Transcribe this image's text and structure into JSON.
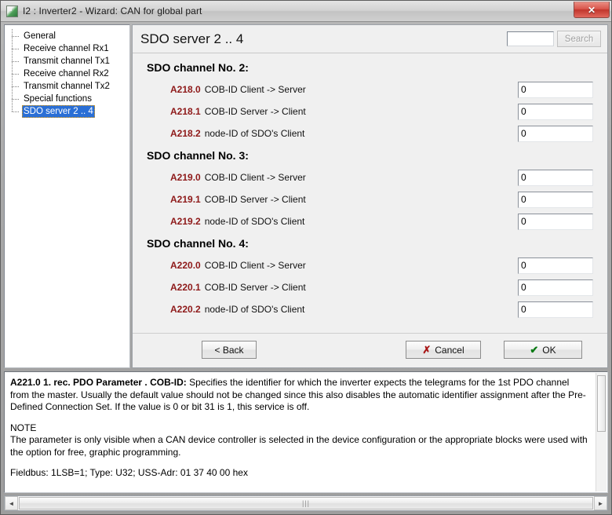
{
  "window": {
    "title": "I2 : Inverter2 - Wizard: CAN for global part",
    "app_icon": "app-square-icon",
    "close_label": "✕"
  },
  "sidebar": {
    "items": [
      {
        "label": "General",
        "selected": false
      },
      {
        "label": "Receive channel Rx1",
        "selected": false
      },
      {
        "label": "Transmit channel Tx1",
        "selected": false
      },
      {
        "label": "Receive channel Rx2",
        "selected": false
      },
      {
        "label": "Transmit channel Tx2",
        "selected": false
      },
      {
        "label": "Special functions",
        "selected": false
      },
      {
        "label": "SDO server 2 .. 4",
        "selected": true
      }
    ]
  },
  "header": {
    "page_title": "SDO server 2 .. 4",
    "search_value": "",
    "search_placeholder": "",
    "search_button": "Search"
  },
  "channels": [
    {
      "title": "SDO channel No. 2:",
      "rows": [
        {
          "code": "A218.0",
          "label": "COB-ID Client -> Server",
          "value": "0"
        },
        {
          "code": "A218.1",
          "label": "COB-ID Server -> Client",
          "value": "0"
        },
        {
          "code": "A218.2",
          "label": "node-ID of SDO's Client",
          "value": "0"
        }
      ]
    },
    {
      "title": "SDO channel No. 3:",
      "rows": [
        {
          "code": "A219.0",
          "label": "COB-ID Client -> Server",
          "value": "0"
        },
        {
          "code": "A219.1",
          "label": "COB-ID Server -> Client",
          "value": "0"
        },
        {
          "code": "A219.2",
          "label": "node-ID of SDO's Client",
          "value": "0"
        }
      ]
    },
    {
      "title": "SDO channel No. 4:",
      "rows": [
        {
          "code": "A220.0",
          "label": "COB-ID Client -> Server",
          "value": "0"
        },
        {
          "code": "A220.1",
          "label": "COB-ID Server -> Client",
          "value": "0"
        },
        {
          "code": "A220.2",
          "label": "node-ID of SDO's Client",
          "value": "0"
        }
      ]
    }
  ],
  "buttons": {
    "back": "< Back",
    "cancel": "Cancel",
    "cancel_icon": "✗",
    "ok": "OK",
    "ok_icon": "✔"
  },
  "help": {
    "param_bold": "A221.0  1. rec. PDO Parameter . COB-ID:",
    "param_text": " Specifies the identifier for which the inverter expects the telegrams for the 1st PDO channel from the master. Usually the default value should not be changed since this also disables the automatic identifier assignment after the Pre-Defined Connection Set. If the value is 0 or bit 31 is 1, this service is off.",
    "note_title": "NOTE",
    "note_text": "The parameter is only visible when a CAN device controller is selected in the device configuration or the appropriate blocks were used with the option for free, graphic programming.",
    "fieldbus": "Fieldbus: 1LSB=1; Type: U32; USS-Adr: 01 37 40 00 hex"
  },
  "scrollbar": {
    "left_arrow": "◄",
    "right_arrow": "►",
    "grip": "|||"
  },
  "colors": {
    "param_code": "#8e1919",
    "selection": "#2a6fd6",
    "close_button": "#c0352c",
    "ok_check": "#0a7a14",
    "cancel_x": "#a81313"
  }
}
